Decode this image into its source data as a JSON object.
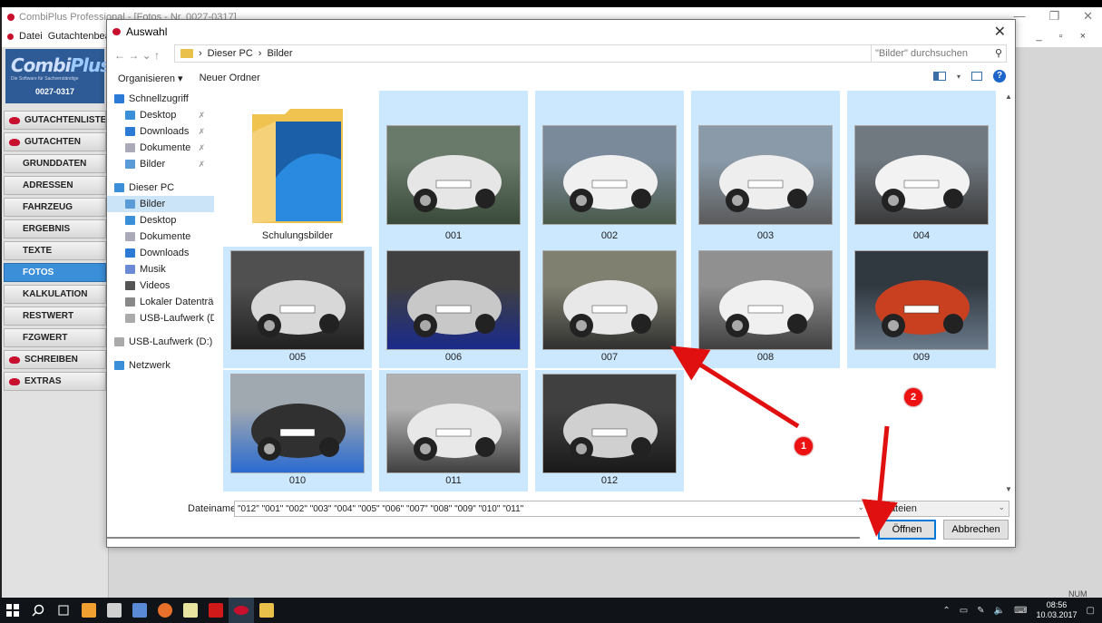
{
  "app": {
    "title": "CombiPlus Professional - [Fotos - Nr. 0027-0317]",
    "menu": [
      "Datei",
      "Gutachtenbear"
    ],
    "window_controls": [
      "—",
      "❐",
      "✕"
    ],
    "mdi_controls": "_ ▫ ×",
    "logo_brand_main": "Combi",
    "logo_brand_accent": "Plus",
    "logo_tagline": "Die Software für Sachverständige",
    "case_number": "0027-0317",
    "nav": [
      {
        "label": "GUTACHTENLISTE",
        "icon": true,
        "active": false
      },
      {
        "label": "GUTACHTEN",
        "icon": true,
        "active": false
      },
      {
        "label": "GRUNDDATEN",
        "icon": false,
        "active": false
      },
      {
        "label": "ADRESSEN",
        "icon": false,
        "active": false
      },
      {
        "label": "FAHRZEUG",
        "icon": false,
        "active": false
      },
      {
        "label": "ERGEBNIS",
        "icon": false,
        "active": false
      },
      {
        "label": "TEXTE",
        "icon": false,
        "active": false
      },
      {
        "label": "FOTOS",
        "icon": false,
        "active": true
      },
      {
        "label": "KALKULATION",
        "icon": false,
        "active": false
      },
      {
        "label": "RESTWERT",
        "icon": false,
        "active": false
      },
      {
        "label": "FZGWERT",
        "icon": false,
        "active": false
      },
      {
        "label": "SCHREIBEN",
        "icon": true,
        "active": false
      },
      {
        "label": "EXTRAS",
        "icon": true,
        "active": false
      }
    ],
    "status_num": "NUM"
  },
  "dialog": {
    "title": "Auswahl",
    "close": "✕",
    "nav_arrows": "←  →  ⌄  ↑",
    "breadcrumb": [
      "Dieser PC",
      "Bilder"
    ],
    "breadcrumb_sep": "›",
    "refresh": "↻",
    "search_placeholder": "\"Bilder\" durchsuchen",
    "toolbar": {
      "organize": "Organisieren ▾",
      "new_folder": "Neuer Ordner",
      "help": "?"
    },
    "nav_pane": [
      {
        "label": "Schnellzugriff",
        "kind": "root",
        "icon": "star",
        "pin": false,
        "selected": false
      },
      {
        "label": "Desktop",
        "kind": "child",
        "icon": "desktop",
        "pin": true,
        "selected": false
      },
      {
        "label": "Downloads",
        "kind": "child",
        "icon": "downloads",
        "pin": true,
        "selected": false
      },
      {
        "label": "Dokumente",
        "kind": "child",
        "icon": "documents",
        "pin": true,
        "selected": false
      },
      {
        "label": "Bilder",
        "kind": "child",
        "icon": "pictures",
        "pin": true,
        "selected": false
      },
      {
        "label": "Dieser PC",
        "kind": "root",
        "icon": "pc",
        "pin": false,
        "selected": false
      },
      {
        "label": "Bilder",
        "kind": "child",
        "icon": "pictures",
        "pin": false,
        "selected": true
      },
      {
        "label": "Desktop",
        "kind": "child",
        "icon": "desktop",
        "pin": false,
        "selected": false
      },
      {
        "label": "Dokumente",
        "kind": "child",
        "icon": "documents",
        "pin": false,
        "selected": false
      },
      {
        "label": "Downloads",
        "kind": "child",
        "icon": "downloads",
        "pin": false,
        "selected": false
      },
      {
        "label": "Musik",
        "kind": "child",
        "icon": "music",
        "pin": false,
        "selected": false
      },
      {
        "label": "Videos",
        "kind": "child",
        "icon": "videos",
        "pin": false,
        "selected": false
      },
      {
        "label": "Lokaler Datenträger",
        "kind": "child",
        "icon": "disk",
        "pin": false,
        "selected": false
      },
      {
        "label": "USB-Laufwerk (D:)",
        "kind": "child",
        "icon": "usb",
        "pin": false,
        "selected": false
      },
      {
        "label": "USB-Laufwerk (D:)",
        "kind": "root",
        "icon": "usb",
        "pin": false,
        "selected": false
      },
      {
        "label": "Netzwerk",
        "kind": "root",
        "icon": "network",
        "pin": false,
        "selected": false
      }
    ],
    "pin_glyph": "✗",
    "files": [
      {
        "name": "Schulungsbilder",
        "type": "folder",
        "selected": false
      },
      {
        "name": "001",
        "type": "photo",
        "selected": true
      },
      {
        "name": "002",
        "type": "photo",
        "selected": true
      },
      {
        "name": "003",
        "type": "photo",
        "selected": true
      },
      {
        "name": "004",
        "type": "photo",
        "selected": true
      },
      {
        "name": "005",
        "type": "photo",
        "selected": true
      },
      {
        "name": "006",
        "type": "photo",
        "selected": true
      },
      {
        "name": "007",
        "type": "photo",
        "selected": true
      },
      {
        "name": "008",
        "type": "photo",
        "selected": true
      },
      {
        "name": "009",
        "type": "photo",
        "selected": true
      },
      {
        "name": "010",
        "type": "photo",
        "selected": true
      },
      {
        "name": "011",
        "type": "photo",
        "selected": true
      },
      {
        "name": "012",
        "type": "photo",
        "selected": true
      }
    ],
    "filename_label": "Dateiname:",
    "filename_value": "\"012\" \"001\" \"002\" \"003\" \"004\" \"005\" \"006\" \"007\" \"008\" \"009\" \"010\" \"011\"",
    "filter_value": "Dateien",
    "open_button": "Öffnen",
    "cancel_button": "Abbrechen"
  },
  "annotations": [
    {
      "label": "1"
    },
    {
      "label": "2"
    }
  ],
  "taskbar": {
    "time": "08:56",
    "date": "10.03.2017",
    "tray_icons": [
      "chevron-up-icon",
      "network-icon",
      "pen-icon",
      "volume-icon",
      "keyboard-icon"
    ]
  }
}
